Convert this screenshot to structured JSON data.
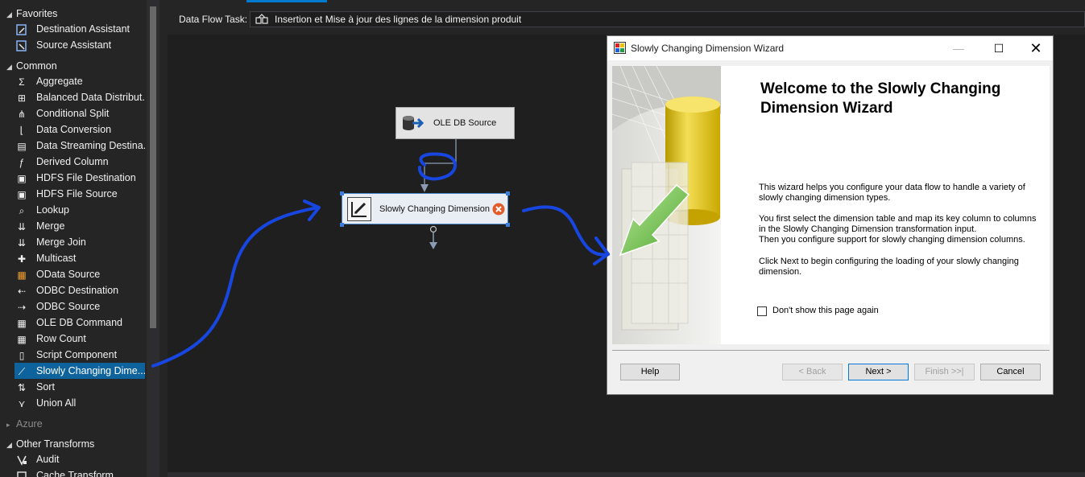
{
  "toolbox": {
    "favorites": {
      "label": "Favorites",
      "items": [
        {
          "label": "Destination Assistant",
          "icon": "destination-assistant-icon"
        },
        {
          "label": "Source Assistant",
          "icon": "source-assistant-icon"
        }
      ]
    },
    "common": {
      "label": "Common",
      "items": [
        {
          "label": "Aggregate",
          "icon": "aggregate-icon"
        },
        {
          "label": "Balanced Data Distribut...",
          "icon": "balanced-data-distributor-icon"
        },
        {
          "label": "Conditional Split",
          "icon": "conditional-split-icon"
        },
        {
          "label": "Data Conversion",
          "icon": "data-conversion-icon"
        },
        {
          "label": "Data Streaming Destina...",
          "icon": "data-streaming-destination-icon"
        },
        {
          "label": "Derived Column",
          "icon": "derived-column-icon"
        },
        {
          "label": "HDFS File Destination",
          "icon": "hdfs-file-destination-icon"
        },
        {
          "label": "HDFS File Source",
          "icon": "hdfs-file-source-icon"
        },
        {
          "label": "Lookup",
          "icon": "lookup-icon"
        },
        {
          "label": "Merge",
          "icon": "merge-icon"
        },
        {
          "label": "Merge Join",
          "icon": "merge-join-icon"
        },
        {
          "label": "Multicast",
          "icon": "multicast-icon"
        },
        {
          "label": "OData Source",
          "icon": "odata-source-icon"
        },
        {
          "label": "ODBC Destination",
          "icon": "odbc-destination-icon"
        },
        {
          "label": "ODBC Source",
          "icon": "odbc-source-icon"
        },
        {
          "label": "OLE DB Command",
          "icon": "ole-db-command-icon"
        },
        {
          "label": "Row Count",
          "icon": "row-count-icon"
        },
        {
          "label": "Script Component",
          "icon": "script-component-icon"
        },
        {
          "label": "Slowly Changing Dime...",
          "icon": "slowly-changing-dimension-icon"
        },
        {
          "label": "Sort",
          "icon": "sort-icon"
        },
        {
          "label": "Union All",
          "icon": "union-all-icon"
        }
      ]
    },
    "azure": {
      "label": "Azure"
    },
    "other_transforms": {
      "label": "Other Transforms",
      "items": [
        {
          "label": "Audit",
          "icon": "audit-icon"
        },
        {
          "label": "Cache Transform",
          "icon": "cache-transform-icon"
        }
      ]
    }
  },
  "header": {
    "label": "Data Flow Task:",
    "task_name": "Insertion et Mise à jour des lignes de la dimension produit"
  },
  "canvas": {
    "source_component": "OLE DB Source",
    "scd_component": "Slowly Changing Dimension"
  },
  "wizard": {
    "title": "Slowly Changing Dimension Wizard",
    "heading": "Welcome to the Slowly Changing Dimension Wizard",
    "paragraph1": "This wizard helps you configure your data flow to handle a variety of slowly changing dimension types.",
    "paragraph2": " You first select the dimension table and map its key column to columns in the Slowly Changing Dimension transformation input.\n Then you configure support for slowly changing dimension columns.",
    "paragraph3": " Click Next to begin configuring the loading of your slowly changing dimension.",
    "dont_show_label": "Don't show this page again",
    "buttons": {
      "help": "Help",
      "back": "< Back",
      "next": "Next >",
      "finish": "Finish >>|",
      "cancel": "Cancel"
    }
  },
  "colors": {
    "selection": "#0e639c",
    "annotation": "#1746e0",
    "error": "#e35d2c"
  }
}
